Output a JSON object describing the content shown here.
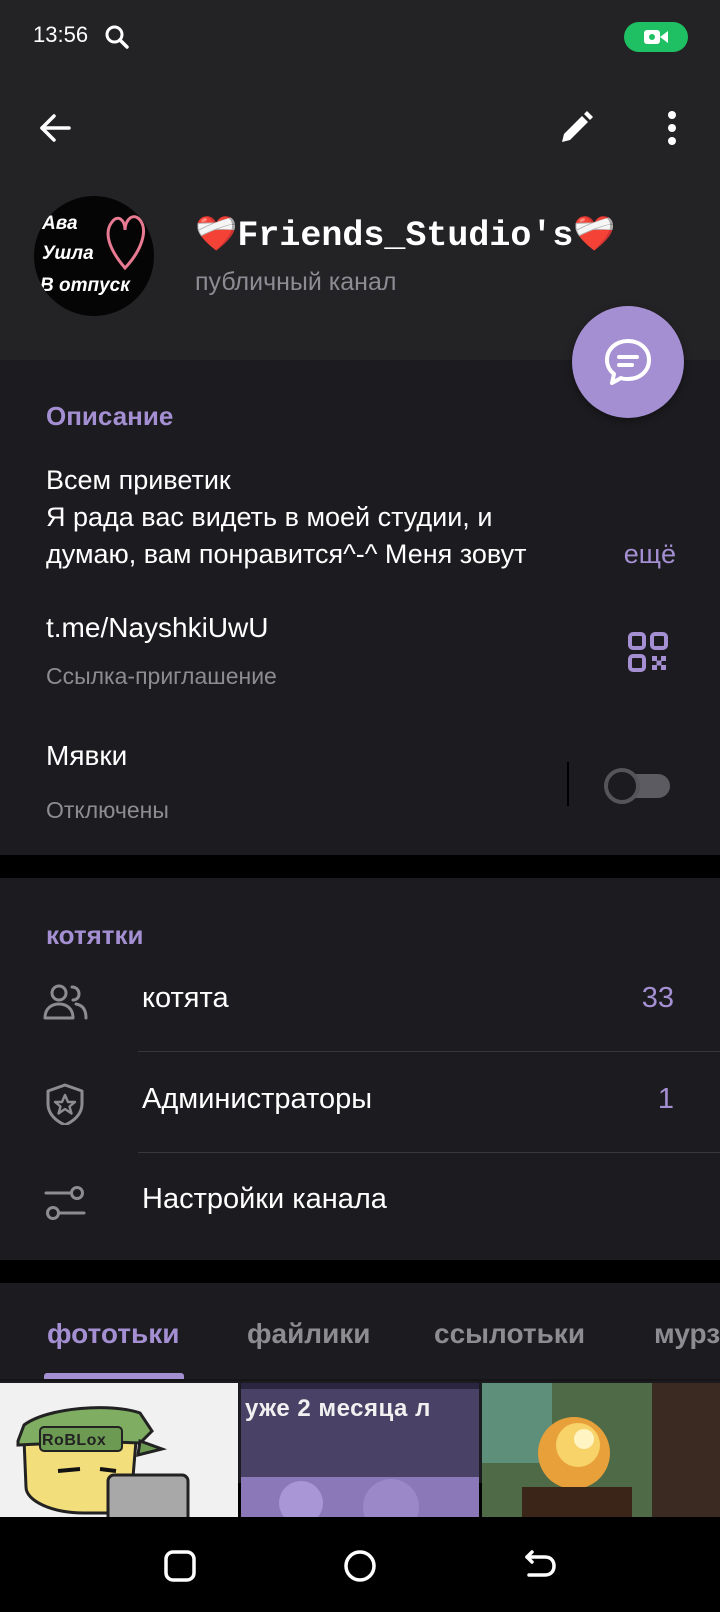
{
  "status": {
    "time": "13:56",
    "icons": [
      "search-icon",
      "video-call-icon"
    ],
    "cam_color": "#1fbf63"
  },
  "header": {
    "title": "Friends_Studio's",
    "subtitle": "публичный канал",
    "title_decoration": "❤️‍🩹",
    "actions": [
      "back-icon",
      "edit-icon",
      "more-vert-icon"
    ]
  },
  "avatar": {
    "lines": [
      "Ава",
      "Ушла",
      "В отпуск"
    ]
  },
  "accent_color": "#a48fd2",
  "info": {
    "heading": "Описание",
    "description_lines": [
      "Всем приветик",
      "Я рада вас видеть в моей студии, и",
      "думаю, вам понравится^-^ Меня зовут"
    ],
    "more_label": "ещё",
    "link": "t.me/NayshkiUwU",
    "link_caption": "Ссылка-приглашение",
    "notifications_label": "Мявки",
    "notifications_state": "Отключены",
    "notifications_enabled": false
  },
  "members": {
    "heading": "котятки",
    "rows": [
      {
        "icon": "people-icon",
        "label": "котята",
        "count": "33"
      },
      {
        "icon": "admin-shield-icon",
        "label": "Администраторы",
        "count": "1"
      },
      {
        "icon": "settings-sliders-icon",
        "label": "Настройки канала",
        "count": ""
      }
    ]
  },
  "media": {
    "tabs": [
      "фототьки",
      "файлики",
      "ссылотьки",
      "мурзилки"
    ],
    "active_tab": 0,
    "thumb_texts": [
      "RoBLox",
      "уже 2 месяца л"
    ]
  },
  "navbar": {
    "buttons": [
      "recents-icon",
      "home-icon",
      "back-nav-icon"
    ]
  }
}
